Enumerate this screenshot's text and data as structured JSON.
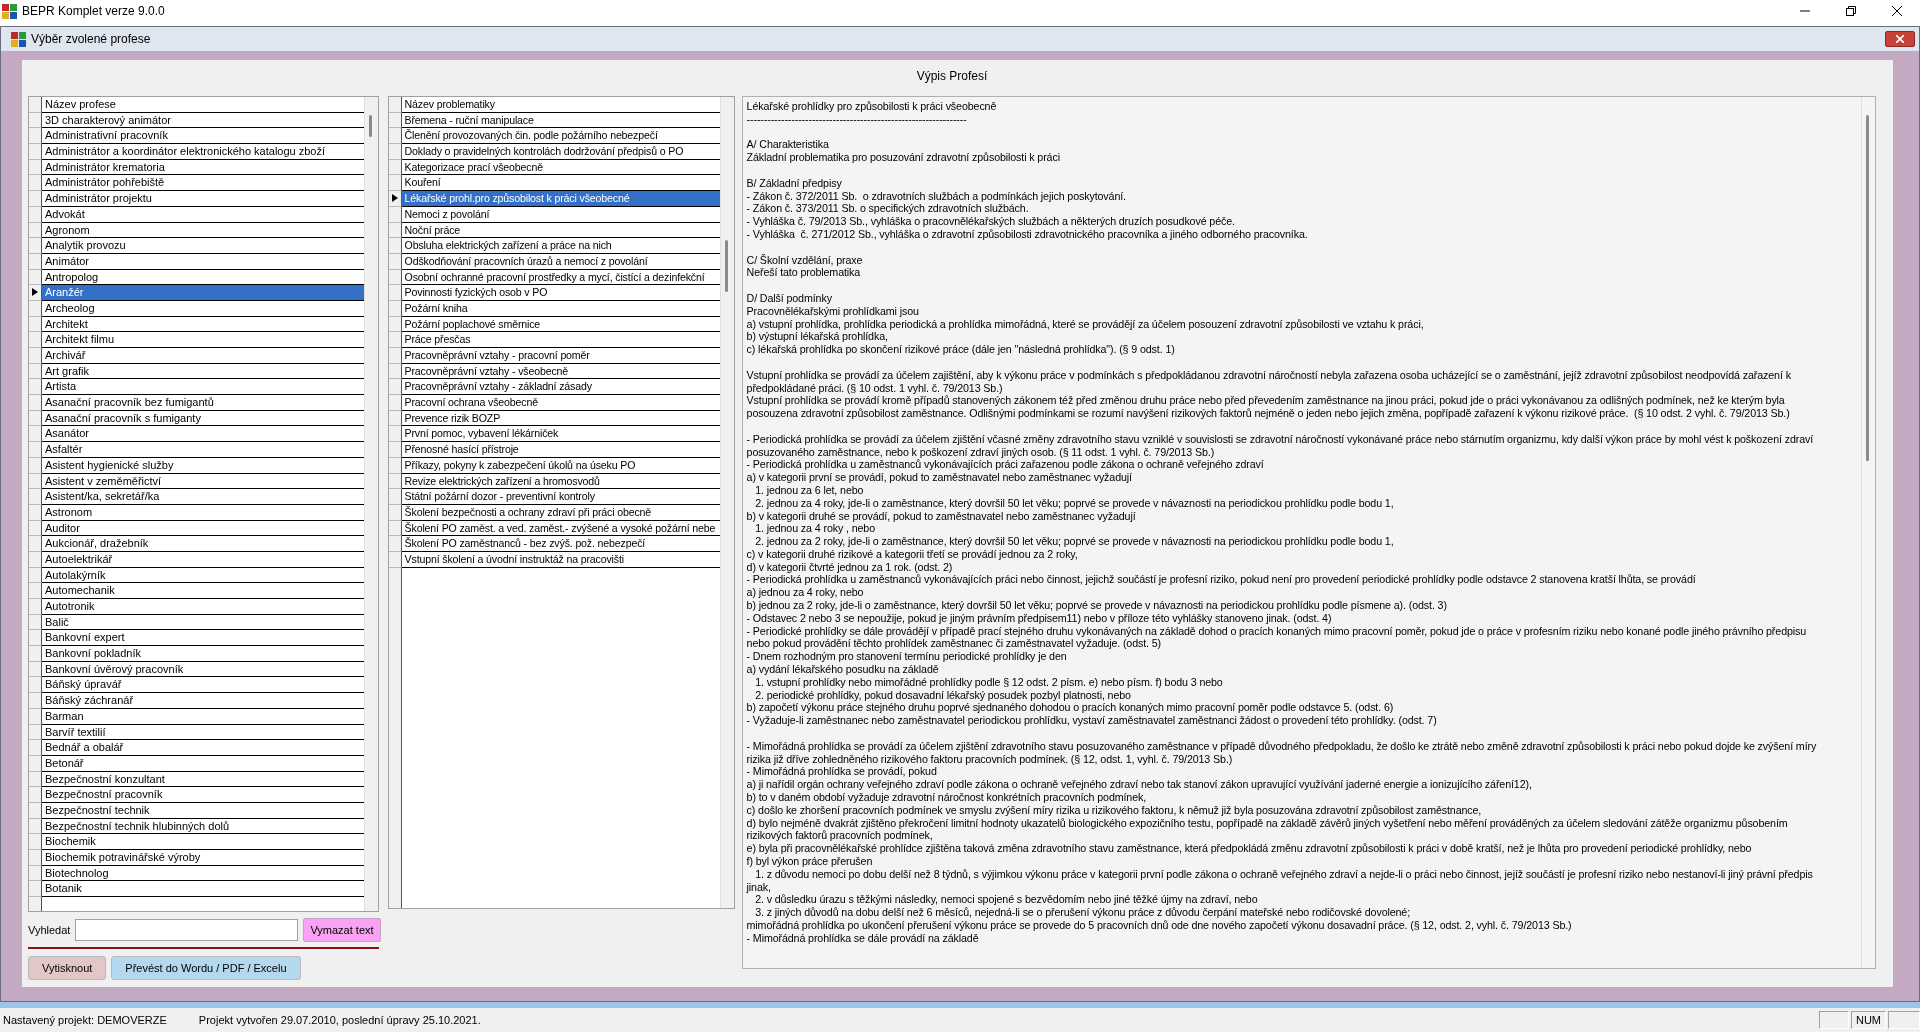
{
  "app": {
    "title": "BEPR Komplet verze 9.0.0"
  },
  "dialog": {
    "title": "Výběr zvolené profese",
    "heading": "Výpis Profesí"
  },
  "professions": {
    "column": "Název profese",
    "rows": [
      {
        "name": "3D charakterový animátor",
        "selected": false
      },
      {
        "name": "Administrativní pracovník",
        "selected": false
      },
      {
        "name": "Administrátor a koordinátor elektronického katalogu zboží",
        "selected": false
      },
      {
        "name": "Administrátor krematoria",
        "selected": false
      },
      {
        "name": "Administrátor pohřebiště",
        "selected": false
      },
      {
        "name": "Administrátor projektu",
        "selected": false
      },
      {
        "name": "Advokát",
        "selected": false
      },
      {
        "name": "Agronom",
        "selected": false
      },
      {
        "name": "Analytik provozu",
        "selected": false
      },
      {
        "name": "Animátor",
        "selected": false
      },
      {
        "name": "Antropolog",
        "selected": false
      },
      {
        "name": "Aranžér",
        "selected": true
      },
      {
        "name": "Archeolog",
        "selected": false
      },
      {
        "name": "Architekt",
        "selected": false
      },
      {
        "name": "Architekt filmu",
        "selected": false
      },
      {
        "name": "Archivář",
        "selected": false
      },
      {
        "name": "Art grafik",
        "selected": false
      },
      {
        "name": "Artista",
        "selected": false
      },
      {
        "name": "Asanační pracovník bez fumigantů",
        "selected": false
      },
      {
        "name": "Asanační pracovník s fumiganty",
        "selected": false
      },
      {
        "name": "Asanátor",
        "selected": false
      },
      {
        "name": "Asfaltér",
        "selected": false
      },
      {
        "name": "Asistent hygienické služby",
        "selected": false
      },
      {
        "name": "Asistent v zeměměřictví",
        "selected": false
      },
      {
        "name": "Asistent/ka, sekretář/ka",
        "selected": false
      },
      {
        "name": "Astronom",
        "selected": false
      },
      {
        "name": "Auditor",
        "selected": false
      },
      {
        "name": "Aukcionář, dražebník",
        "selected": false
      },
      {
        "name": "Autoelektrikář",
        "selected": false
      },
      {
        "name": "Autolakýrník",
        "selected": false
      },
      {
        "name": "Automechanik",
        "selected": false
      },
      {
        "name": "Autotronik",
        "selected": false
      },
      {
        "name": "Balič",
        "selected": false
      },
      {
        "name": "Bankovní expert",
        "selected": false
      },
      {
        "name": "Bankovní pokladník",
        "selected": false
      },
      {
        "name": "Bankovní úvěrový pracovník",
        "selected": false
      },
      {
        "name": "Báňský úpravář",
        "selected": false
      },
      {
        "name": "Báňský záchranář",
        "selected": false
      },
      {
        "name": "Barman",
        "selected": false
      },
      {
        "name": "Barvíř textilií",
        "selected": false
      },
      {
        "name": "Bednář a obalář",
        "selected": false
      },
      {
        "name": "Betonář",
        "selected": false
      },
      {
        "name": "Bezpečnostní konzultant",
        "selected": false
      },
      {
        "name": "Bezpečnostní pracovník",
        "selected": false
      },
      {
        "name": "Bezpečnostní technik",
        "selected": false
      },
      {
        "name": "Bezpečnostní technik hlubinných dolů",
        "selected": false
      },
      {
        "name": "Biochemik",
        "selected": false
      },
      {
        "name": "Biochemik potravinářské výroby",
        "selected": false
      },
      {
        "name": "Biotechnolog",
        "selected": false
      },
      {
        "name": "Botanik",
        "selected": false
      }
    ]
  },
  "topics": {
    "column": "Název problematiky",
    "rows": [
      {
        "name": "Břemena - ruční manipulace",
        "selected": false
      },
      {
        "name": "Členění provozovaných čin. podle požárního nebezpečí",
        "selected": false
      },
      {
        "name": "Doklady o pravidelných kontrolách dodržování předpisů o PO",
        "selected": false
      },
      {
        "name": "Kategorizace prací všeobecně",
        "selected": false
      },
      {
        "name": "Kouření",
        "selected": false
      },
      {
        "name": "Lékařské prohl.pro způsobilost k práci všeobecné",
        "selected": true
      },
      {
        "name": "Nemoci z povolání",
        "selected": false
      },
      {
        "name": "Noční práce",
        "selected": false
      },
      {
        "name": "Obsluha elektrických zařízení a práce na nich",
        "selected": false
      },
      {
        "name": "Odškodňování pracovních úrazů a nemocí z povolání",
        "selected": false
      },
      {
        "name": "Osobní ochranné pracovní prostředky a mycí, čistící a dezinfekční",
        "selected": false
      },
      {
        "name": "Povinnosti fyzických osob v PO",
        "selected": false
      },
      {
        "name": "Požární kniha",
        "selected": false
      },
      {
        "name": "Požární poplachové směrnice",
        "selected": false
      },
      {
        "name": "Práce přesčas",
        "selected": false
      },
      {
        "name": "Pracovněprávní vztahy - pracovní poměr",
        "selected": false
      },
      {
        "name": "Pracovněprávní vztahy - všeobecně",
        "selected": false
      },
      {
        "name": "Pracovněprávní vztahy - základní zásady",
        "selected": false
      },
      {
        "name": "Pracovní ochrana všeobecně",
        "selected": false
      },
      {
        "name": "Prevence rizik BOZP",
        "selected": false
      },
      {
        "name": "První pomoc, vybavení lékárniček",
        "selected": false
      },
      {
        "name": "Přenosné hasící přístroje",
        "selected": false
      },
      {
        "name": "Příkazy, pokyny k zabezpečení úkolů na úseku PO",
        "selected": false
      },
      {
        "name": "Revize elektrických zařízení a hromosvodů",
        "selected": false
      },
      {
        "name": "Státní požární dozor - preventivní kontroly",
        "selected": false
      },
      {
        "name": "Školení bezpečnosti a ochrany zdraví při práci obecně",
        "selected": false
      },
      {
        "name": "Školení PO zaměst. a ved. zaměst.- zvýšené a vysoké požární nebe",
        "selected": false
      },
      {
        "name": "Školení PO zaměstnanců - bez zvýš. pož. nebezpečí",
        "selected": false
      },
      {
        "name": "Vstupní školení a úvodní instruktáž na pracovišti",
        "selected": false
      }
    ]
  },
  "detail": {
    "blocks": [
      [
        "Lékařské prohlídky pro způsobilosti k práci všeobecně",
        "----------------------------------------------------------------"
      ],
      [
        "A/ Charakteristika",
        "Základní problematika pro posuzování zdravotní způsobilosti k práci"
      ],
      [
        "B/ Základní předpisy",
        "- Zákon č. 372/2011 Sb.  o zdravotních službách a podmínkách jejich poskytování.",
        "- Zákon č. 373/2011 Sb. o specifických zdravotních službách.",
        "- Vyhláška č. 79/2013 Sb., vyhláška o pracovnělékařských službách a některých druzích posudkové péče.",
        "- Vyhláška  č. 271/2012 Sb., vyhláška o zdravotní způsobilosti zdravotnického pracovníka a jiného odborného pracovníka."
      ],
      [
        "C/ Školní vzdělání, praxe",
        "Neřeší tato problematika"
      ],
      [
        "D/ Další podmínky",
        "Pracovnělékařskými prohlídkami jsou",
        "a) vstupní prohlídka, prohlídka periodická a prohlídka mimořádná, které se provádějí za účelem posouzení zdravotní způsobilosti ve vztahu k práci,",
        "b) výstupní lékařská prohlídka,",
        "c) lékařská prohlídka po skončení rizikové práce (dále jen \"následná prohlídka\"). (§ 9 odst. 1)"
      ],
      [
        "Vstupní prohlídka se provádí za účelem zajištění, aby k výkonu práce v podmínkách s předpokládanou zdravotní náročností nebyla zařazena osoba ucházející se o zaměstnání, jejíž zdravotní způsobilost neodpovídá zařazení k",
        "předpokládané práci. (§ 10 odst. 1 vyhl. č. 79/2013 Sb.)",
        "Vstupní prohlídka se provádí kromě případů stanovených zákonem též před změnou druhu práce nebo před převedením zaměstnance na jinou práci, pokud jde o práci vykonávanou za odlišných podmínek, než ke kterým byla",
        "posouzena zdravotní způsobilost zaměstnance. Odlišnými podmínkami se rozumí navýšení rizikových faktorů nejméně o jeden nebo jejich změna, popřípadě zařazení k výkonu rizikové práce.  (§ 10 odst. 2 vyhl. č. 79/2013 Sb.)"
      ],
      [
        "- Periodická prohlídka se provádí za účelem zjištění včasné změny zdravotního stavu vzniklé v souvislosti se zdravotní náročností vykonávané práce nebo stárnutím organizmu, kdy další výkon práce by mohl vést k poškození zdraví",
        "posuzovaného zaměstnance, nebo k poškození zdraví jiných osob. (§ 11 odst. 1 vyhl. č. 79/2013 Sb.)",
        "- Periodická prohlídka u zaměstnanců vykonávajících práci zařazenou podle zákona o ochraně veřejného zdraví",
        "a) v kategorii první se provádí, pokud to zaměstnavatel nebo zaměstnanec vyžadují",
        "   1. jednou za 6 let, nebo",
        "   2. jednou za 4 roky, jde-li o zaměstnance, který dovršil 50 let věku; poprvé se provede v návaznosti na periodickou prohlídku podle bodu 1,",
        "b) v kategorii druhé se provádí, pokud to zaměstnavatel nebo zaměstnanec vyžadují",
        "   1. jednou za 4 roky , nebo",
        "   2. jednou za 2 roky, jde-li o zaměstnance, který dovršil 50 let věku; poprvé se provede v návaznosti na periodickou prohlídku podle bodu 1,",
        "c) v kategorii druhé rizikové a kategorii třetí se provádí jednou za 2 roky,",
        "d) v kategorii čtvrté jednou za 1 rok. (odst. 2)",
        "- Periodická prohlídka u zaměstnanců vykonávajících práci nebo činnost, jejichž součástí je profesní riziko, pokud není pro provedení periodické prohlídky podle odstavce 2 stanovena kratší lhůta, se provádí",
        "a) jednou za 4 roky, nebo",
        "b) jednou za 2 roky, jde-li o zaměstnance, který dovršil 50 let věku; poprvé se provede v návaznosti na periodickou prohlídku podle písmene a). (odst. 3)",
        "- Odstavec 2 nebo 3 se nepoužije, pokud je jiným právním předpisem11) nebo v příloze této vyhlášky stanoveno jinak. (odst. 4)",
        "- Periodické prohlídky se dále provádějí v případě prací stejného druhu vykonávaných na základě dohod o pracích konaných mimo pracovní poměr, pokud jde o práce v profesním riziku nebo konané podle jiného právního předpisu",
        "nebo pokud provádění těchto prohlídek zaměstnanec či zaměstnavatel vyžaduje. (odst. 5)",
        "- Dnem rozhodným pro stanovení termínu periodické prohlídky je den",
        "a) vydání lékařského posudku na základě",
        "   1. vstupní prohlídky nebo mimořádné prohlídky podle § 12 odst. 2 písm. e) nebo písm. f) bodu 3 nebo",
        "   2. periodické prohlídky, pokud dosavadní lékařský posudek pozbyl platnosti, nebo",
        "b) započetí výkonu práce stejného druhu poprvé sjednaného dohodou o pracích konaných mimo pracovní poměr podle odstavce 5. (odst. 6)",
        "- Vyžaduje-li zaměstnanec nebo zaměstnavatel periodickou prohlídku, vystaví zaměstnavatel zaměstnanci žádost o provedení této prohlídky. (odst. 7)"
      ],
      [
        "- Mimořádná prohlídka se provádí za účelem zjištění zdravotního stavu posuzovaného zaměstnance v případě důvodného předpokladu, že došlo ke ztrátě nebo změně zdravotní způsobilosti k práci nebo pokud dojde ke zvýšení míry",
        "rizika již dříve zohledněného rizikového faktoru pracovních podmínek. (§ 12, odst. 1, vyhl. č. 79/2013 Sb.)",
        "- Mimořádná prohlídka se provádí, pokud",
        "a) ji nařídil orgán ochrany veřejného zdraví podle zákona o ochraně veřejného zdraví nebo tak stanoví zákon upravující využívání jaderné energie a ionizujícího záření12),",
        "b) to v daném období vyžaduje zdravotní náročnost konkrétních pracovních podmínek,",
        "c) došlo ke zhoršení pracovních podmínek ve smyslu zvýšení míry rizika u rizikového faktoru, k němuž již byla posuzována zdravotní způsobilost zaměstnance,",
        "d) bylo nejméně dvakrát zjištěno překročení limitní hodnoty ukazatelů biologického expozičního testu, popřípadě na základě závěrů jiných vyšetření nebo měření prováděných za účelem sledování zátěže organizmu působením",
        "rizikových faktorů pracovních podmínek,",
        "e) byla při pracovnělékařské prohlídce zjištěna taková změna zdravotního stavu zaměstnance, která předpokládá změnu zdravotní způsobilosti k práci v době kratší, než je lhůta pro provedení periodické prohlídky, nebo",
        "f) byl výkon práce přerušen",
        "   1. z důvodu nemoci po dobu delší než 8 týdnů, s výjimkou výkonu práce v kategorii první podle zákona o ochraně veřejného zdraví a nejde-li o práci nebo činnost, jejíž součástí je profesní riziko nebo nestanoví-li jiný právní předpis",
        "jinak,",
        "   2. v důsledku úrazu s těžkými následky, nemoci spojené s bezvědomím nebo jiné těžké újmy na zdraví, nebo",
        "   3. z jiných důvodů na dobu delší než 6 měsíců, nejedná-li se o přerušení výkonu práce z důvodu čerpání mateřské nebo rodičovské dovolené;",
        "mimořádná prohlídka po ukončení přerušení výkonu práce se provede do 5 pracovních dnů ode dne nového započetí výkonu dosavadní práce. (§ 12, odst. 2, vyhl. č. 79/2013 Sb.)",
        "- Mimořádná prohlídka se dále provádí na základě"
      ]
    ]
  },
  "search": {
    "label": "Vyhledat",
    "clear_button": "Vymazat text"
  },
  "buttons": [
    {
      "label": "Vytisknout",
      "color": "#e2c6c8"
    },
    {
      "label": "Převést do Wordu / PDF / Excelu",
      "color": "#b4d9ee"
    }
  ],
  "status_bar": {
    "project": "Nastavený projekt: DEMOVERZE",
    "info": "Projekt vytvořen 29.07.2010, poslední úpravy 25.10.2021.",
    "indicator": "NUM"
  }
}
